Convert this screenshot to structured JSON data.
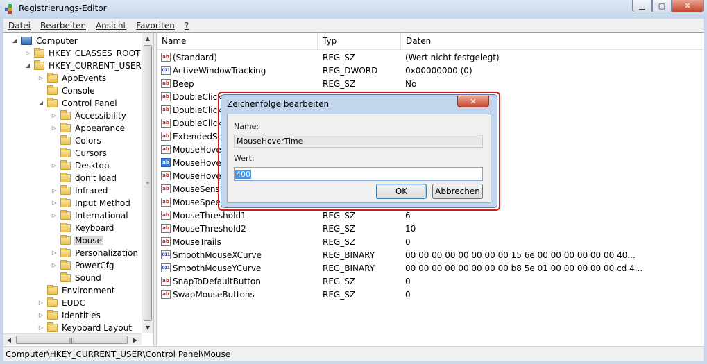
{
  "window": {
    "title": "Registrierungs-Editor",
    "minimize": "▁",
    "maximize": "▢",
    "close": "✕"
  },
  "menu": [
    "Datei",
    "Bearbeiten",
    "Ansicht",
    "Favoriten",
    "?"
  ],
  "tree": {
    "items": [
      {
        "label": "Computer",
        "level": 0,
        "expander": "◢",
        "icon": "computer-icon"
      },
      {
        "label": "HKEY_CLASSES_ROOT",
        "level": 1,
        "expander": "▷",
        "icon": "folder-icon"
      },
      {
        "label": "HKEY_CURRENT_USER",
        "level": 1,
        "expander": "◢",
        "icon": "folder-icon"
      },
      {
        "label": "AppEvents",
        "level": 2,
        "expander": "▷",
        "icon": "folder-icon"
      },
      {
        "label": "Console",
        "level": 2,
        "expander": "",
        "icon": "folder-icon"
      },
      {
        "label": "Control Panel",
        "level": 2,
        "expander": "◢",
        "icon": "folder-icon"
      },
      {
        "label": "Accessibility",
        "level": 3,
        "expander": "▷",
        "icon": "folder-icon"
      },
      {
        "label": "Appearance",
        "level": 3,
        "expander": "▷",
        "icon": "folder-icon"
      },
      {
        "label": "Colors",
        "level": 3,
        "expander": "",
        "icon": "folder-icon"
      },
      {
        "label": "Cursors",
        "level": 3,
        "expander": "",
        "icon": "folder-icon"
      },
      {
        "label": "Desktop",
        "level": 3,
        "expander": "▷",
        "icon": "folder-icon"
      },
      {
        "label": "don't load",
        "level": 3,
        "expander": "",
        "icon": "folder-icon"
      },
      {
        "label": "Infrared",
        "level": 3,
        "expander": "▷",
        "icon": "folder-icon"
      },
      {
        "label": "Input Method",
        "level": 3,
        "expander": "▷",
        "icon": "folder-icon"
      },
      {
        "label": "International",
        "level": 3,
        "expander": "▷",
        "icon": "folder-icon"
      },
      {
        "label": "Keyboard",
        "level": 3,
        "expander": "",
        "icon": "folder-icon"
      },
      {
        "label": "Mouse",
        "level": 3,
        "expander": "",
        "icon": "folder-icon",
        "selected": true
      },
      {
        "label": "Personalization",
        "level": 3,
        "expander": "▷",
        "icon": "folder-icon"
      },
      {
        "label": "PowerCfg",
        "level": 3,
        "expander": "▷",
        "icon": "folder-icon"
      },
      {
        "label": "Sound",
        "level": 3,
        "expander": "",
        "icon": "folder-icon"
      },
      {
        "label": "Environment",
        "level": 2,
        "expander": "",
        "icon": "folder-icon"
      },
      {
        "label": "EUDC",
        "level": 2,
        "expander": "▷",
        "icon": "folder-icon"
      },
      {
        "label": "Identities",
        "level": 2,
        "expander": "▷",
        "icon": "folder-icon"
      },
      {
        "label": "Keyboard Layout",
        "level": 2,
        "expander": "▷",
        "icon": "folder-icon"
      }
    ]
  },
  "list": {
    "columns": [
      "Name",
      "Typ",
      "Daten"
    ],
    "rows": [
      {
        "name": "(Standard)",
        "type": "REG_SZ",
        "data": "(Wert nicht festgelegt)",
        "icon": "ab"
      },
      {
        "name": "ActiveWindowTracking",
        "type": "REG_DWORD",
        "data": "0x00000000 (0)",
        "icon": "bin"
      },
      {
        "name": "Beep",
        "type": "REG_SZ",
        "data": "No",
        "icon": "ab"
      },
      {
        "name": "DoubleClick",
        "type": "",
        "data": "",
        "icon": "ab"
      },
      {
        "name": "DoubleClick",
        "type": "",
        "data": "",
        "icon": "ab"
      },
      {
        "name": "DoubleClick",
        "type": "",
        "data": "",
        "icon": "ab"
      },
      {
        "name": "ExtendedSou",
        "type": "",
        "data": "",
        "icon": "ab"
      },
      {
        "name": "MouseHove",
        "type": "",
        "data": "",
        "icon": "ab"
      },
      {
        "name": "MouseHove",
        "type": "",
        "data": "",
        "icon": "ab",
        "selected": true
      },
      {
        "name": "MouseHove",
        "type": "",
        "data": "",
        "icon": "ab"
      },
      {
        "name": "MouseSensi",
        "type": "",
        "data": "",
        "icon": "ab"
      },
      {
        "name": "MouseSpeed",
        "type": "",
        "data": "",
        "icon": "ab"
      },
      {
        "name": "MouseThreshold1",
        "type": "REG_SZ",
        "data": "6",
        "icon": "ab"
      },
      {
        "name": "MouseThreshold2",
        "type": "REG_SZ",
        "data": "10",
        "icon": "ab"
      },
      {
        "name": "MouseTrails",
        "type": "REG_SZ",
        "data": "0",
        "icon": "ab"
      },
      {
        "name": "SmoothMouseXCurve",
        "type": "REG_BINARY",
        "data": "00 00 00 00 00 00 00 00 15 6e 00 00 00 00 00 00 40...",
        "icon": "bin"
      },
      {
        "name": "SmoothMouseYCurve",
        "type": "REG_BINARY",
        "data": "00 00 00 00 00 00 00 00 b8 5e 01 00 00 00 00 00 cd 4...",
        "icon": "bin"
      },
      {
        "name": "SnapToDefaultButton",
        "type": "REG_SZ",
        "data": "0",
        "icon": "ab"
      },
      {
        "name": "SwapMouseButtons",
        "type": "REG_SZ",
        "data": "0",
        "icon": "ab"
      }
    ]
  },
  "status": {
    "path": "Computer\\HKEY_CURRENT_USER\\Control Panel\\Mouse"
  },
  "dialog": {
    "title": "Zeichenfolge bearbeiten",
    "close": "✕",
    "name_label": "Name:",
    "name_value": "MouseHoverTime",
    "value_label": "Wert:",
    "value": "400",
    "ok": "OK",
    "cancel": "Abbrechen"
  },
  "colors": {
    "highlight": "#3399ff",
    "dialog_frame": "#c2d5ec",
    "annotation": "#d21a1a"
  }
}
